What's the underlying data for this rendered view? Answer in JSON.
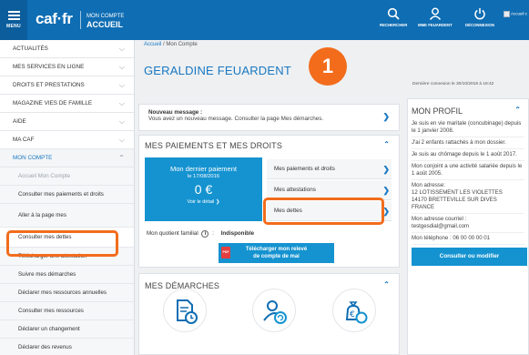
{
  "header": {
    "menu_label": "MENU",
    "logo": "caf·fr",
    "title_small": "MON COMPTE",
    "title_big": "ACCUEIL",
    "actions": [
      {
        "label": "RECHERCHER",
        "icon": "search-icon"
      },
      {
        "label": "MME FEUARDENT",
        "icon": "user-icon"
      },
      {
        "label": "DÉCONNEXION",
        "icon": "power-icon"
      }
    ],
    "user_corner": "Accueil c"
  },
  "sidebar": {
    "items": [
      {
        "label": "ACTUALITÉS"
      },
      {
        "label": "MES SERVICES EN LIGNE"
      },
      {
        "label": "DROITS ET PRESTATIONS"
      },
      {
        "label": "MAGAZINE VIES DE FAMILLE"
      },
      {
        "label": "AIDE"
      },
      {
        "label": "MA CAF"
      },
      {
        "label": "MON COMPTE"
      }
    ],
    "subitems": [
      {
        "label": "Accueil Mon Compte"
      },
      {
        "label": "Consulter mes paiements et droits"
      },
      {
        "label": "Aller à la page mes"
      },
      {
        "label": "Consulter mes dettes"
      },
      {
        "label": "Télécharger une attestation"
      },
      {
        "label": "Suivre mes démarches"
      },
      {
        "label": "Déclarer mes ressources annuelles"
      },
      {
        "label": "Consulter mes ressources"
      },
      {
        "label": "Déclarer un changement"
      },
      {
        "label": "Déclarer des revenus"
      }
    ]
  },
  "main": {
    "breadcrumb": {
      "home": "Accueil",
      "sep": "/",
      "current": "Mon Compte"
    },
    "page_title": "GERALDINE FEUARDENT",
    "step_number": "1",
    "last_connection": "Dernière connexion le 30/10/2018 à 18:42",
    "message": {
      "heading": "Nouveau message :",
      "body": "Vous avez un nouveau message. Consulter la page Mes démarches."
    },
    "payments": {
      "heading": "MES PAIEMENTS ET MES DROITS",
      "last_payment_title": "Mon dernier paiement",
      "last_payment_date": "le 17/08/2016",
      "last_payment_amount": "0 €",
      "last_payment_detail": "Voir le détail ❯",
      "links": [
        "Mes paiements et droits",
        "Mes attestations",
        "Mes dettes"
      ],
      "quotient_label": "Mon quotient familial",
      "quotient_sep": ":",
      "quotient_value": "Indisponible",
      "download_label_1": "Télécharger mon relevé",
      "download_label_2": "de compte de mai",
      "pdf_label": "PDF"
    },
    "demarches": {
      "heading": "MES DÉMARCHES"
    }
  },
  "profile": {
    "heading": "MON PROFIL",
    "lines": [
      "Je suis en vie maritale (concubinage) depuis le 1 janvier 2008.",
      "J'ai 2 enfants rattachés à mon dossier.",
      "Je suis au chômage depuis le 1 août 2017.",
      "Mon conjoint a une activité salariée depuis le 1 août 2005.",
      "Mon adresse:\n12 LOTISSEMENT LES VIOLETTES\n14170 BRETTEVILLE SUR DIVES\nFRANCE",
      "Mon adresse courriel :\ntestgesdial@gmail.com",
      "Mon téléphone : 06 00 00 00 01"
    ],
    "button": "Consulter ou modifier"
  },
  "colors": {
    "header_blue": "#0f6db3",
    "accent_blue": "#1593d0",
    "highlight_orange": "#f26c1c",
    "title_blue": "#1a78c2"
  }
}
